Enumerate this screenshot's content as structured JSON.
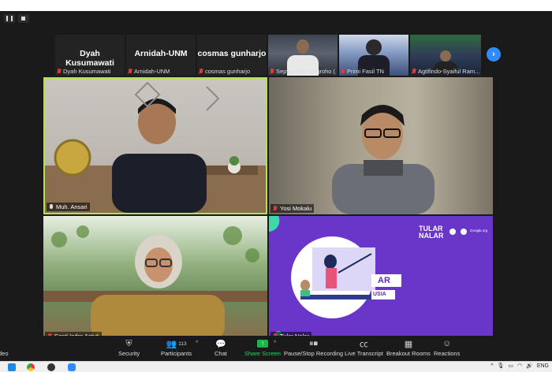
{
  "thumbnails": [
    {
      "display_name": "Dyah Kusumawati",
      "label": "Dyah Kusumawati",
      "type": "name"
    },
    {
      "display_name": "Arnidah-UNM",
      "label": "Arnidah-UNM",
      "type": "name"
    },
    {
      "display_name": "cosmas gunharjo",
      "label": "cosmas gunharjo",
      "type": "name"
    },
    {
      "label": "Septiaji Eko Nugroho (...",
      "type": "video"
    },
    {
      "label": "Primi Fasil TN",
      "type": "video"
    },
    {
      "label": "Agtifindo-Syaiful Ram...",
      "type": "video"
    }
  ],
  "main_tiles": {
    "ansari": {
      "label": "Muh. Ansari"
    },
    "yosi": {
      "label": "Yosi Mokalu"
    },
    "santi": {
      "label": "Santi Indra Astuti"
    },
    "tular": {
      "label": "Tular Nalar",
      "logo_line1": "TULAR",
      "logo_line2": "NALAR",
      "slide_text1": "AR",
      "slide_text2": "USIA",
      "partner_text": "Google.org"
    }
  },
  "toolbar": {
    "left_partial": "deo",
    "security": "Security",
    "participants": "Participants",
    "participants_count": "113",
    "chat": "Chat",
    "share_screen": "Share Screen",
    "recording": "Pause/Stop Recording",
    "live_transcript": "Live Transcript",
    "breakout_rooms": "Breakout Rooms",
    "reactions": "Reactions"
  },
  "taskbar": {
    "language": "ENG"
  },
  "colors": {
    "active_speaker": "#b7e34a",
    "share_green": "#1fb34a",
    "accent_blue": "#2d8cff",
    "tular_purple": "#6a35c9"
  }
}
